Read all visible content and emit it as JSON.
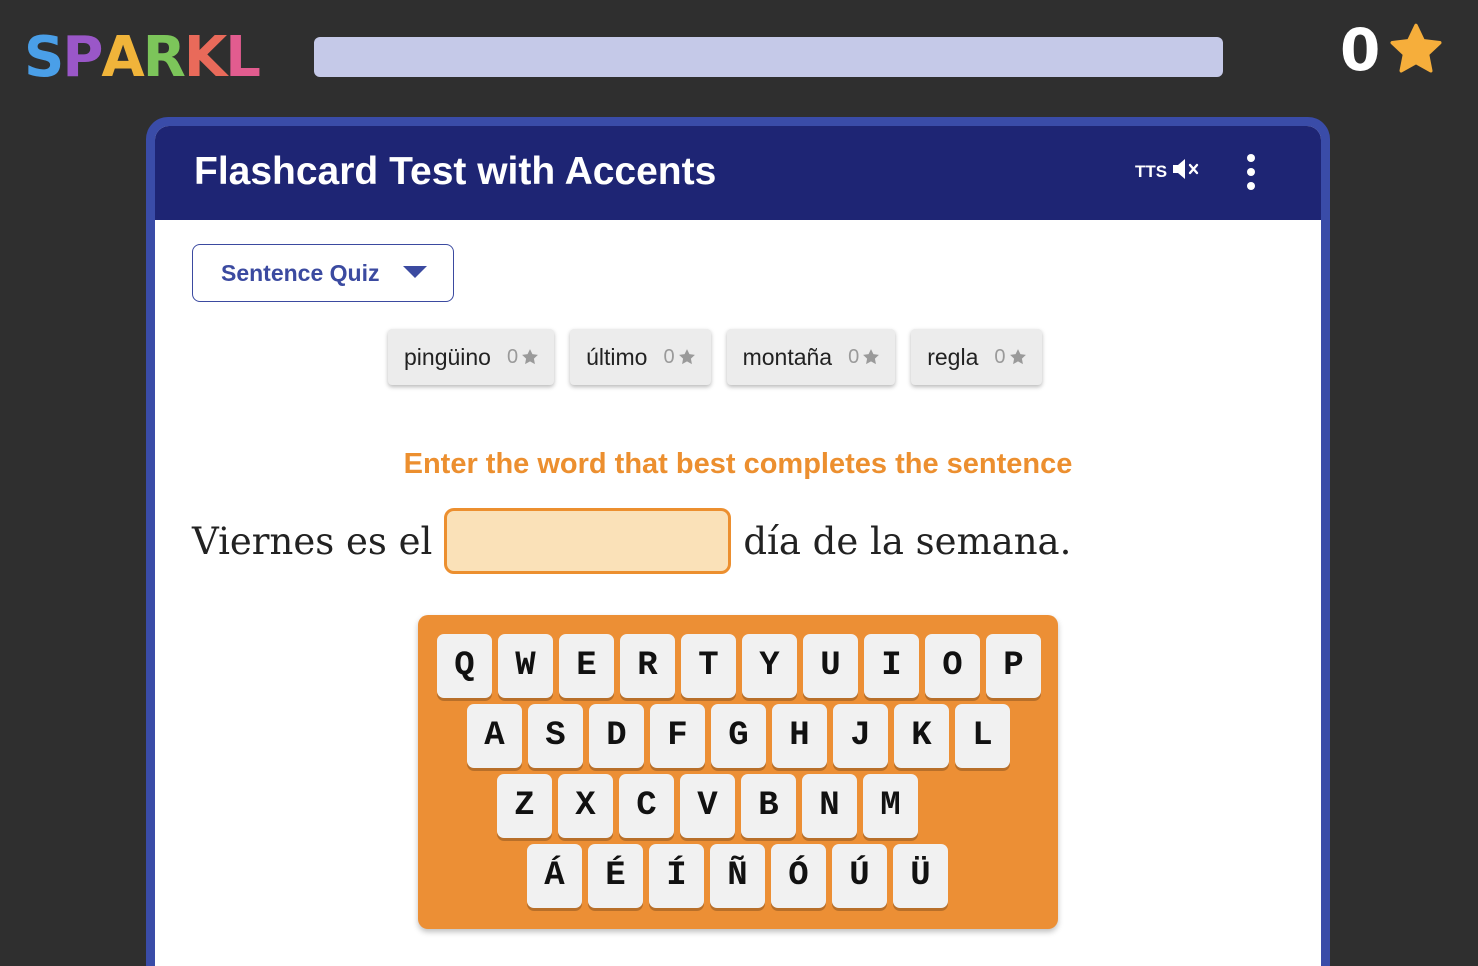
{
  "app": {
    "logo_letters": [
      {
        "char": "S",
        "color": "#4a9fe8"
      },
      {
        "char": "P",
        "color": "#9a57c8"
      },
      {
        "char": "A",
        "color": "#f0b43a"
      },
      {
        "char": "R",
        "color": "#7cc55a"
      },
      {
        "char": "K",
        "color": "#e96a5a"
      },
      {
        "char": "L",
        "color": "#e25c8f"
      }
    ],
    "score": "0",
    "score_icon": "star-icon",
    "accent_star": "#f6ae3b"
  },
  "card": {
    "title": "Flashcard Test with Accents",
    "tts_label": "TTS",
    "tts_icon": "speaker-muted-icon",
    "menu_icon": "more-vertical-icon",
    "header_color": "#1e2574"
  },
  "mode": {
    "selected": "Sentence Quiz"
  },
  "words": [
    {
      "word": "pingüino",
      "stars": "0"
    },
    {
      "word": "último",
      "stars": "0"
    },
    {
      "word": "montaña",
      "stars": "0"
    },
    {
      "word": "regla",
      "stars": "0"
    }
  ],
  "quiz": {
    "prompt": "Enter the word that best completes the sentence",
    "sentence_before": "Viernes es el",
    "sentence_after": "día de la semana.",
    "answer_value": ""
  },
  "keyboard": {
    "rows": [
      [
        "Q",
        "W",
        "E",
        "R",
        "T",
        "Y",
        "U",
        "I",
        "O",
        "P"
      ],
      [
        "A",
        "S",
        "D",
        "F",
        "G",
        "H",
        "J",
        "K",
        "L"
      ],
      [
        "Z",
        "X",
        "C",
        "V",
        "B",
        "N",
        "M"
      ],
      [
        "Á",
        "É",
        "Í",
        "Ñ",
        "Ó",
        "Ú",
        "Ü"
      ]
    ],
    "color": "#ec8f35"
  }
}
